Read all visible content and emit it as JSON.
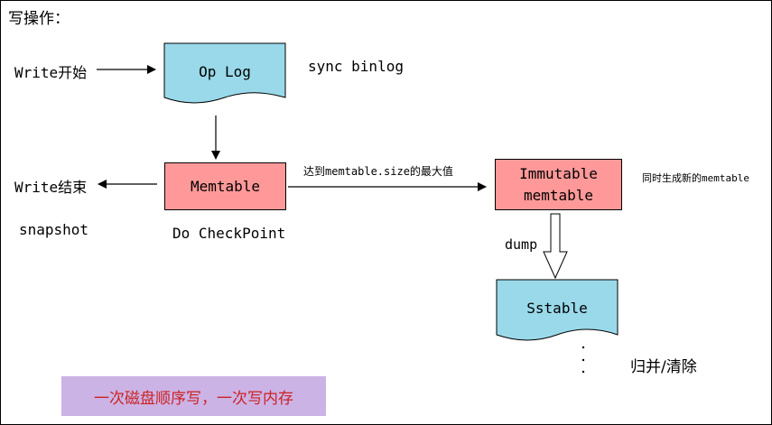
{
  "title": "写操作：",
  "nodes": {
    "oplog": "Op Log",
    "memtable": "Memtable",
    "immutable_line1": "Immutable",
    "immutable_line2": "memtable",
    "sstable": "Sstable"
  },
  "labels": {
    "write_start": "Write开始",
    "write_end": "Write结束",
    "sync_binlog": "sync binlog",
    "snapshot": "snapshot",
    "do_checkpoint": "Do CheckPoint",
    "threshold": "达到memtable.size的最大值",
    "new_memtable": "同时生成新的memtable",
    "dump": "dump",
    "merge_clear": "归并/清除"
  },
  "note": "一次磁盘顺序写，一次写内存",
  "colors": {
    "doc_fill": "#99d9ea",
    "box_fill": "#ff9999",
    "note_bg": "#ccb3e6",
    "note_text": "#cc2222"
  }
}
